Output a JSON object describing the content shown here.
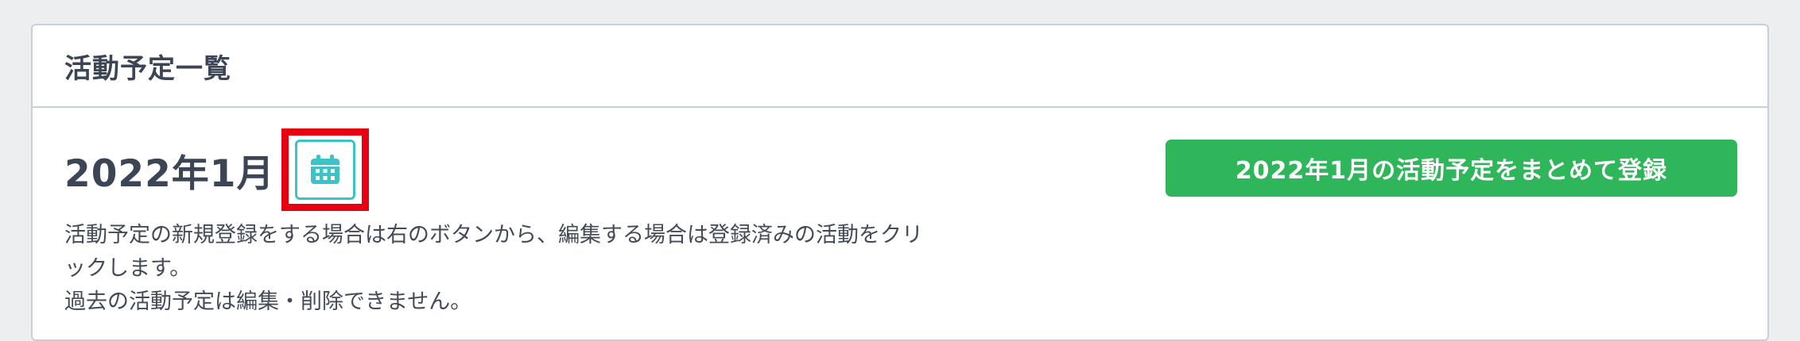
{
  "panel": {
    "title": "活動予定一覧"
  },
  "month": {
    "label": "2022年1月",
    "calendar_icon": "calendar-icon"
  },
  "actions": {
    "bulk_register_label": "2022年1月の活動予定をまとめて登録"
  },
  "description": {
    "line1": "活動予定の新規登録をする場合は右のボタンから、編集する場合は登録済みの活動をクリックします。",
    "line2": "過去の活動予定は編集・削除できません。"
  },
  "colors": {
    "accent_green": "#2fb55a",
    "calendar_teal": "#3cc3c7",
    "highlight_red": "#e60012",
    "text_dark": "#3b4555"
  }
}
